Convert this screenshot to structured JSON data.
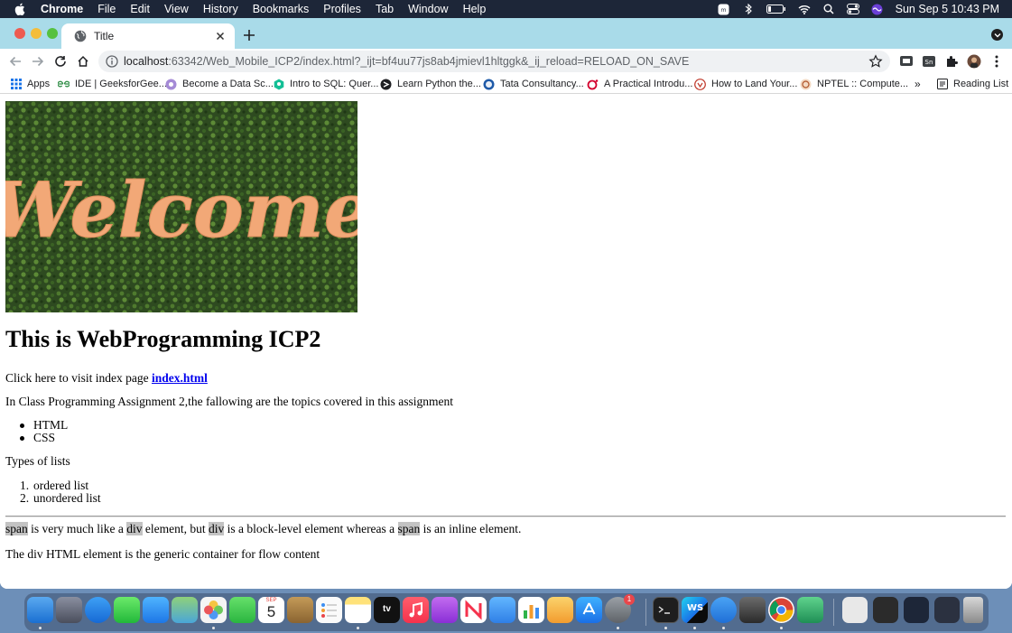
{
  "menubar": {
    "app": "Chrome",
    "menus": [
      "File",
      "Edit",
      "View",
      "History",
      "Bookmarks",
      "Profiles",
      "Tab",
      "Window",
      "Help"
    ],
    "clock": "Sun Sep 5  10:43 PM"
  },
  "browser": {
    "tab_title": "Title",
    "url_host": "localhost",
    "url_rest": ":63342/Web_Mobile_ICP2/index.html?_ijt=bf4uu77js8ab4jmievl1hltggk&_ij_reload=RELOAD_ON_SAVE",
    "bookmarks": [
      "Apps",
      "IDE | GeeksforGee...",
      "Become a Data Sc...",
      "Intro to SQL: Quer...",
      "Learn Python the...",
      "Tata Consultancy...",
      "A Practical Introdu...",
      "How to Land Your...",
      "NPTEL :: Compute..."
    ],
    "bookmarks_overflow": "»",
    "reading_list": "Reading List"
  },
  "page": {
    "image_word": "Welcome",
    "heading": "This is WebProgramming ICP2",
    "visit_text": "Click here to visit index page ",
    "visit_link": "index.html",
    "intro": "In Class Programming Assignment 2,the fallowing are the topics covered in this assignment",
    "topics": [
      "HTML",
      "CSS"
    ],
    "lists_label": "Types of lists",
    "list_types": [
      "ordered list",
      "unordered list"
    ],
    "span_sentence": {
      "w1": "span",
      "t1": " is very much like a ",
      "w2": "div",
      "t2": " element, but ",
      "w3": "div",
      "t3": " is a block-level element whereas a ",
      "w4": "span",
      "t4": " is an inline element."
    },
    "div_sentence": "The div HTML element is the generic container for flow content"
  },
  "dock": {
    "calendar_month": "SEP",
    "calendar_day": "5",
    "tv_label": "tv",
    "settings_badge": "1",
    "webstorm_label": "WS"
  },
  "colors": {
    "tabstrip": "#a9dbe9",
    "link": "#0000ee",
    "highlight": "#c3c3c3"
  }
}
